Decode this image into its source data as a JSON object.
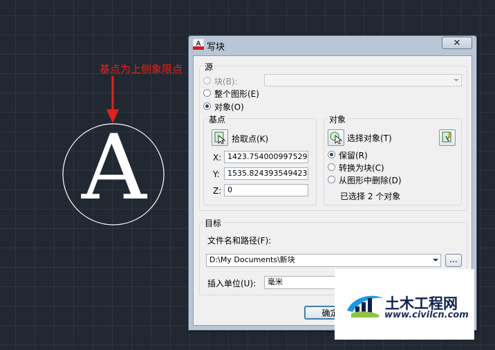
{
  "canvas": {
    "annotation": "基点为上侧象限点",
    "letter": "A"
  },
  "dialog": {
    "title": "写块",
    "close_glyph": "✕",
    "source": {
      "label": "源",
      "block_label": "块(B):",
      "whole_drawing_label": "整个图形(E)",
      "objects_label": "对象(O)",
      "selected": "objects"
    },
    "base_point": {
      "label": "基点",
      "pick_label": "拾取点(K)",
      "x_label": "X:",
      "x_value": "1423.754000997529",
      "y_label": "Y:",
      "y_value": "1535.824393549423",
      "z_label": "Z:",
      "z_value": "0"
    },
    "objects": {
      "label": "对象",
      "select_label": "选择对象(T)",
      "retain_label": "保留(R)",
      "convert_label": "转换为块(C)",
      "delete_label": "从图形中删除(D)",
      "selected_option": "retain",
      "status": "已选择 2 个对象"
    },
    "destination": {
      "label": "目标",
      "file_label": "文件名和路径(F):",
      "file_value": "D:\\My Documents\\新块",
      "browse_label": "...",
      "units_label": "插入单位(U):",
      "units_value": "毫米"
    },
    "ok_label": "确定"
  },
  "watermark": {
    "name": "土木工程网",
    "url": "www.civilcn.com"
  }
}
